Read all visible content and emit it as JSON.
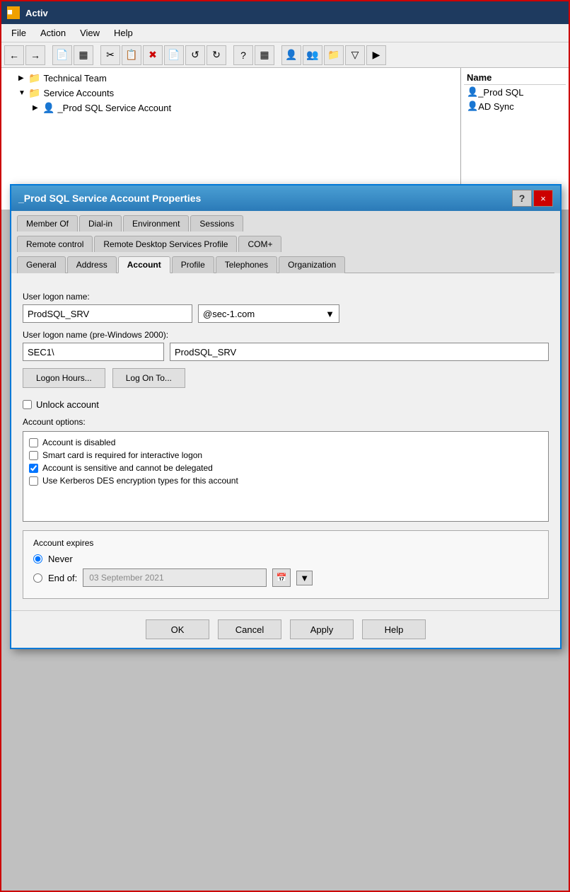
{
  "titlebar": {
    "icon": "■",
    "title": "Activ"
  },
  "menubar": {
    "items": [
      "File",
      "Action",
      "View",
      "Help"
    ]
  },
  "toolbar": {
    "buttons": [
      "←",
      "→",
      "📄",
      "▦",
      "✂",
      "📋",
      "✖",
      "📄",
      "↺",
      "↻",
      "?",
      "▦",
      "👤",
      "👥",
      "📁",
      "▽",
      "▶"
    ]
  },
  "tree": {
    "items": [
      {
        "indent": 1,
        "expand": "▶",
        "icon": "📁",
        "label": "Technical Team"
      },
      {
        "indent": 1,
        "expand": "▼",
        "icon": "📁",
        "label": "Service Accounts"
      },
      {
        "indent": 2,
        "expand": "▶",
        "icon": "👤",
        "label": "_Prod SQL Service Account"
      }
    ]
  },
  "right_panel": {
    "header": "Name",
    "items": [
      {
        "icon": "👤",
        "label": "_Prod SQL"
      },
      {
        "icon": "👤",
        "label": "AD Sync"
      }
    ]
  },
  "dialog": {
    "title": "_Prod SQL Service Account Properties",
    "help_label": "?",
    "close_label": "×",
    "tabs": {
      "row1": [
        "Member Of",
        "Dial-in",
        "Environment",
        "Sessions"
      ],
      "row2": [
        "Remote control",
        "Remote Desktop Services Profile",
        "COM+"
      ],
      "row3": [
        "General",
        "Address",
        "Account",
        "Profile",
        "Telephones",
        "Organization"
      ]
    },
    "active_tab": "Account",
    "form": {
      "logon_label": "User logon name:",
      "logon_value": "ProdSQL_SRV",
      "domain_value": "@sec-1.com",
      "domain_arrow": "▼",
      "logon_pre2000_label": "User logon name (pre-Windows 2000):",
      "pre2000_prefix": "SEC1\\",
      "pre2000_value": "ProdSQL_SRV",
      "logon_hours_btn": "Logon Hours...",
      "logon_to_btn": "Log On To...",
      "unlock_label": "Unlock account",
      "account_options_label": "Account options:",
      "options": [
        {
          "checked": false,
          "label": "Account is disabled"
        },
        {
          "checked": false,
          "label": "Smart card is required for interactive logon"
        },
        {
          "checked": true,
          "label": "Account is sensitive and cannot be delegated"
        },
        {
          "checked": false,
          "label": "Use Kerberos DES encryption types for this account"
        }
      ],
      "expires_title": "Account expires",
      "never_label": "Never",
      "end_of_label": "End of:",
      "date_placeholder": "03 September 2021"
    },
    "footer": {
      "ok": "OK",
      "cancel": "Cancel",
      "apply": "Apply",
      "help": "Help"
    }
  }
}
